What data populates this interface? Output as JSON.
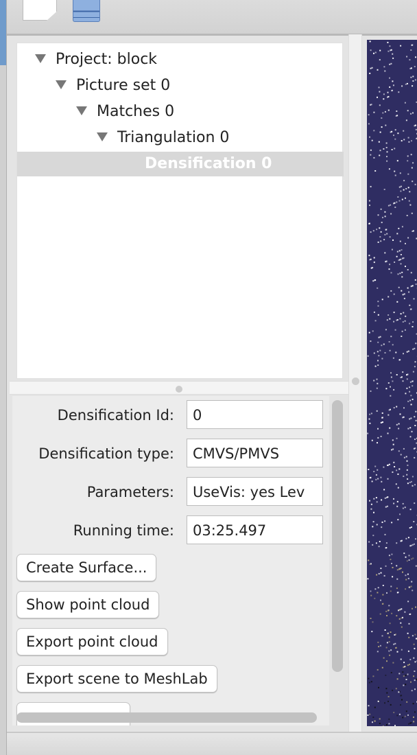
{
  "toolbar": {
    "icons": [
      "new-document-icon",
      "database-icon"
    ]
  },
  "tree": {
    "nodes": [
      {
        "label": "Project: block",
        "expanded": true
      },
      {
        "label": "Picture set 0",
        "expanded": true
      },
      {
        "label": "Matches 0",
        "expanded": true
      },
      {
        "label": "Triangulation 0",
        "expanded": true
      },
      {
        "label": "Densification 0",
        "selected": true
      }
    ]
  },
  "properties": {
    "fields": [
      {
        "label": "Densification Id:",
        "value": "0"
      },
      {
        "label": "Densification type:",
        "value": "CMVS/PMVS"
      },
      {
        "label": "Parameters:",
        "value": "UseVis: yes Lev"
      },
      {
        "label": "Running time:",
        "value": "03:25.497"
      }
    ],
    "buttons": [
      "Create Surface...",
      "Show point cloud",
      "Export point cloud",
      "Export scene to MeshLab"
    ]
  },
  "viewport": {
    "background": "#2f2d62",
    "point_color": "#ffffff"
  }
}
